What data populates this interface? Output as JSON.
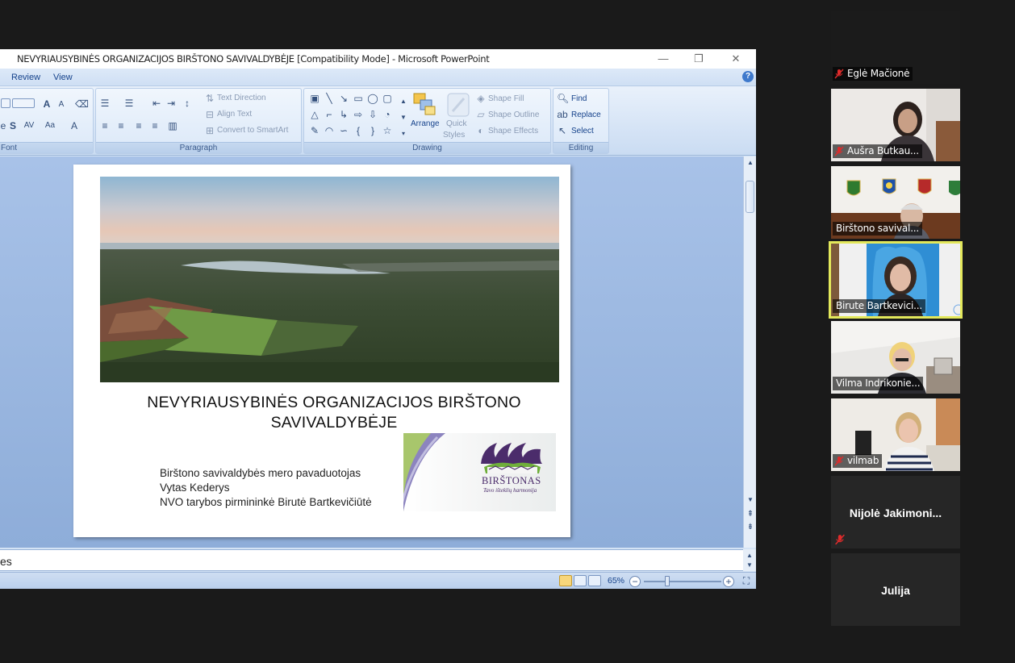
{
  "window": {
    "title": "NEVYRIAUSYBINĖS ORGANIZACIJOS BIRŠTONO SAVIVALDYBĖJE [Compatibility Mode] - Microsoft PowerPoint",
    "minimize": "—",
    "restore": "❐",
    "close": "✕"
  },
  "menu": {
    "review": "Review",
    "view": "View",
    "help": "?"
  },
  "ribbon": {
    "font_group": "Font",
    "paragraph_group": "Paragraph",
    "drawing_group": "Drawing",
    "editing_group": "Editing",
    "text_direction": "Text Direction",
    "align_text": "Align Text",
    "convert_smartart": "Convert to SmartArt",
    "arrange": "Arrange",
    "quick": "Quick",
    "styles": "Styles",
    "shape_fill": "Shape Fill",
    "shape_outline": "Shape Outline",
    "shape_effects": "Shape Effects",
    "find": "Find",
    "replace": "Replace",
    "select": "Select"
  },
  "slide": {
    "title_line1": "NEVYRIAUSYBINĖS ORGANIZACIJOS BIRŠTONO",
    "title_line2": "SAVIVALDYBĖJE",
    "line1": "Birštono savivaldybės mero pavaduotojas",
    "line2": "Vytas Kederys",
    "line3": "NVO tarybos pirmininkė Birutė Bartkevičiūtė",
    "logo_text": "BIRŠTONAS",
    "logo_slogan": "Tavo išteklių harmonija"
  },
  "notes_text": "es",
  "status": {
    "zoom": "65%"
  },
  "participants": [
    {
      "name": "Eglė Mačionė",
      "muted": true
    },
    {
      "name": "Aušra Butkau...",
      "muted": true
    },
    {
      "name": "Birštono savival...",
      "muted": false
    },
    {
      "name": "Birute Bartkevici...",
      "muted": false,
      "active": true
    },
    {
      "name": "Vilma Indrikonie...",
      "muted": false
    },
    {
      "name": "vilmab",
      "muted": true
    },
    {
      "name": "Nijolė  Jakimoni...",
      "muted": true
    },
    {
      "name": "Julija",
      "muted": false
    }
  ],
  "colors": {
    "accent": "#15428b",
    "active_speaker": "#e3e85b",
    "mute_red": "#e02b2b"
  }
}
